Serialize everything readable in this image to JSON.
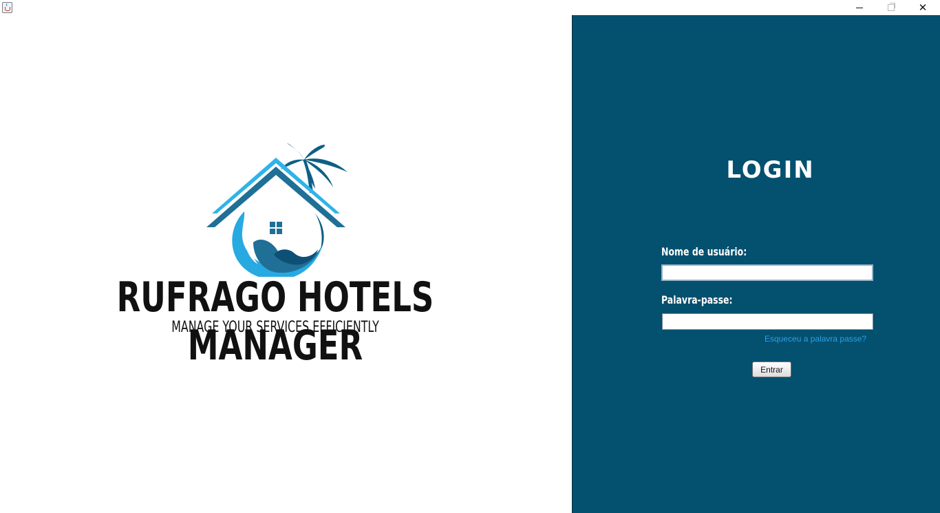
{
  "window": {
    "minimize_icon": "minimize-icon",
    "maximize_icon": "restore-icon",
    "close_icon": "close-icon",
    "close_glyph": "✕"
  },
  "branding": {
    "title": "RUFRAGO HOTELS MANAGER",
    "subtitle": "MANAGE YOUR SERVICES EFFICIENTLY",
    "colors": {
      "roof": "#1f6f96",
      "roof_light": "#2fb3ea",
      "wave_dark": "#0e5f86",
      "wave_light": "#27a9e1",
      "text": "#111111"
    }
  },
  "login": {
    "title": "LOGIN",
    "username_label": "Nome de usuário:",
    "username_value": "",
    "password_label": "Palavra-passe:",
    "password_value": "",
    "forgot_link": "Esqueceu a palavra passe?",
    "submit_label": "Entrar",
    "panel_color": "#03506f",
    "link_color": "#2ea0e6"
  }
}
